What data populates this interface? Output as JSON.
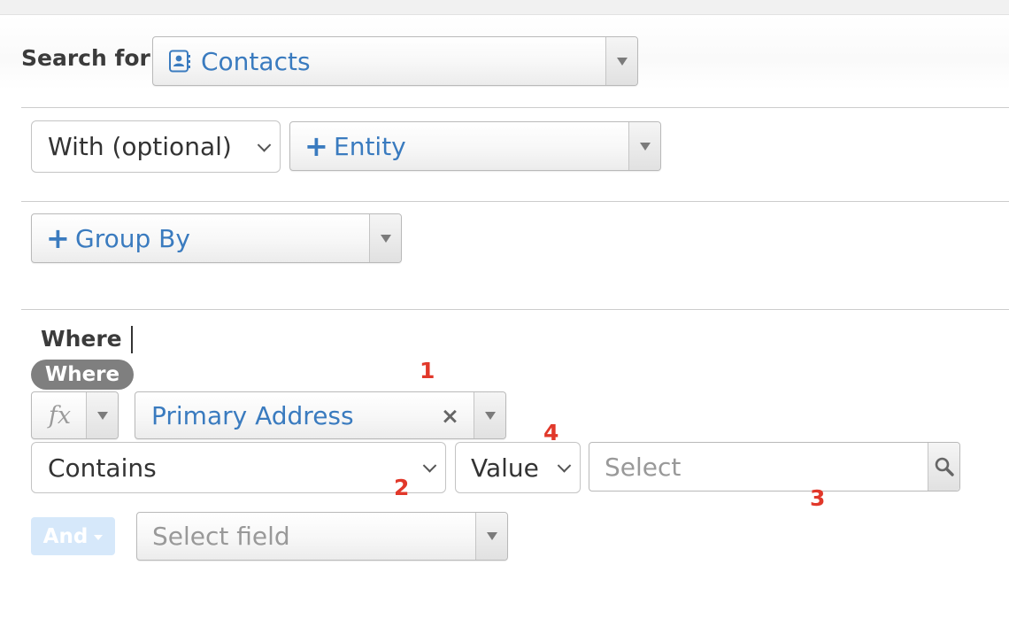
{
  "search_for": {
    "label": "Search for",
    "value": "Contacts",
    "icon": "contact-card-icon"
  },
  "with": {
    "select_value": "With (optional)",
    "entity_label": "Entity",
    "entity_prefix": "+"
  },
  "group_by": {
    "label": "Group By",
    "prefix": "+"
  },
  "where": {
    "title": "Where",
    "pill": "Where",
    "fx_label": "fx",
    "field_value": "Primary Address",
    "clear_symbol": "×",
    "operator_value": "Contains",
    "value_type": "Value",
    "value_placeholder": "Select",
    "and_label": "And",
    "select_field_placeholder": "Select field"
  },
  "annotations": [
    "1",
    "2",
    "3",
    "4"
  ],
  "colors": {
    "accent": "#3a7bbf",
    "annotation": "#e1382a",
    "pill": "#7f7f7f",
    "and_button": "#d6e8fa"
  }
}
